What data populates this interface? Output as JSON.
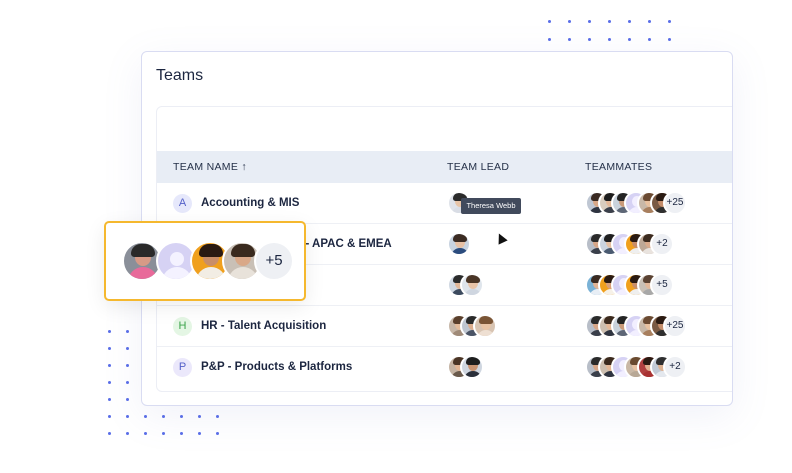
{
  "page_title": "Teams",
  "columns": {
    "team_name": "TEAM NAME ↑",
    "team_lead": "TEAM LEAD",
    "teammates": "TEAMMATES"
  },
  "rows": [
    {
      "initial": "A",
      "badge_bg": "#e6e8fb",
      "badge_fg": "#5460c8",
      "name": "Accounting & MIS",
      "more": "+25"
    },
    {
      "initial": "",
      "badge_bg": "#ffffff",
      "badge_fg": "#5460c8",
      "name": "ent - APAC & EMEA",
      "more": "+2"
    },
    {
      "initial": "",
      "badge_bg": "#ffffff",
      "badge_fg": "#5460c8",
      "name": "",
      "more": "+5"
    },
    {
      "initial": "H",
      "badge_bg": "#e4f6e4",
      "badge_fg": "#3aa24a",
      "name": "HR - Talent Acquisition",
      "more": "+25"
    },
    {
      "initial": "P",
      "badge_bg": "#ebe8fb",
      "badge_fg": "#5460c8",
      "name": "P&P - Products & Platforms",
      "more": "+2"
    }
  ],
  "tooltip": "Theresa Webb",
  "zoom": {
    "more": "+5"
  },
  "colors": {
    "accent": "#5a6ee8",
    "highlight_border": "#f5b82e",
    "header_bg": "#e8edf5"
  }
}
